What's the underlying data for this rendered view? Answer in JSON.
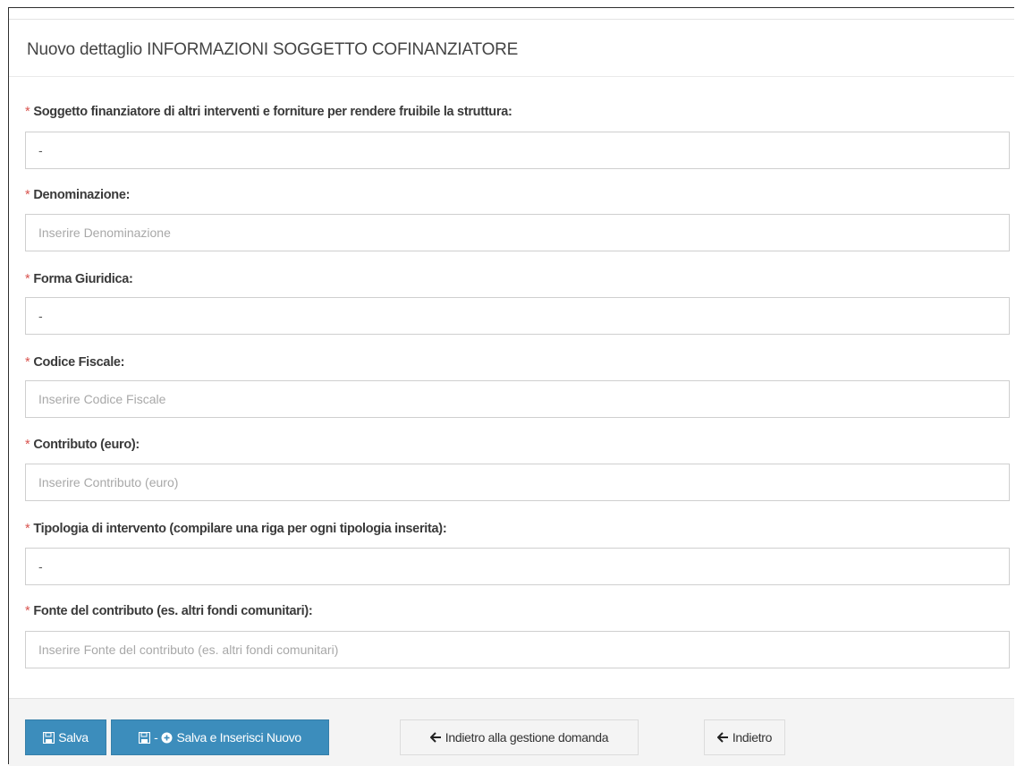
{
  "panel": {
    "title": "Nuovo dettaglio INFORMAZIONI SOGGETTO COFINANZIATORE"
  },
  "form": {
    "required_marker": "*",
    "fields": [
      {
        "label": "Soggetto finanziatore di altri interventi e forniture per rendere fruibile la struttura:",
        "value": "-",
        "placeholder": ""
      },
      {
        "label": "Denominazione:",
        "value": "",
        "placeholder": "Inserire Denominazione"
      },
      {
        "label": "Forma Giuridica:",
        "value": "-",
        "placeholder": ""
      },
      {
        "label": "Codice Fiscale:",
        "value": "",
        "placeholder": "Inserire Codice Fiscale"
      },
      {
        "label": "Contributo (euro):",
        "value": "",
        "placeholder": "Inserire Contributo (euro)"
      },
      {
        "label": "Tipologia di intervento (compilare una riga per ogni tipologia inserita):",
        "value": "-",
        "placeholder": ""
      },
      {
        "label": "Fonte del contributo (es. altri fondi comunitari):",
        "value": "",
        "placeholder": "Inserire Fonte del contributo (es. altri fondi comunitari)"
      }
    ]
  },
  "footer": {
    "save_label": "Salva",
    "save_new_separator": "-",
    "save_new_label": "Salva e Inserisci Nuovo",
    "back_to_management_label": "Indietro alla gestione domanda",
    "back_label": "Indietro"
  },
  "colors": {
    "primary": "#3c8dbc",
    "required": "#d9534f"
  },
  "icons": {
    "save": "floppy-disk-icon",
    "add": "plus-circle-icon",
    "back": "arrow-left-icon"
  }
}
